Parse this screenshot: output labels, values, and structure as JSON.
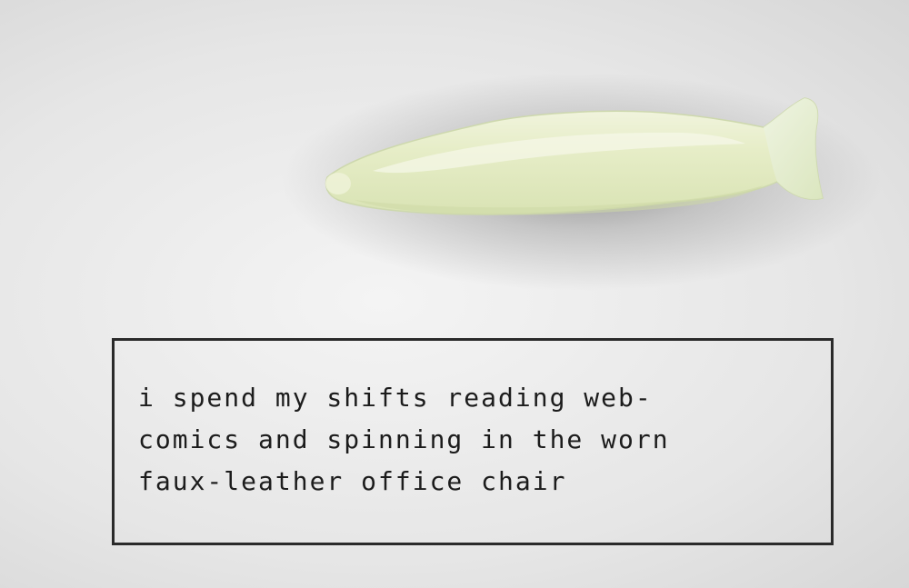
{
  "caption": {
    "lines": [
      "i spend my shifts reading web-",
      "comics and spinning in the worn",
      "faux-leather office chair"
    ]
  },
  "colors": {
    "fish_body": "#e4ebc6",
    "fish_highlight": "#f2f5e0",
    "fish_edge": "#c9d4a8",
    "box_border": "#2a2a2a",
    "text": "#1c1c1c"
  },
  "icons": {
    "main_image": "translucent-fish-image"
  }
}
